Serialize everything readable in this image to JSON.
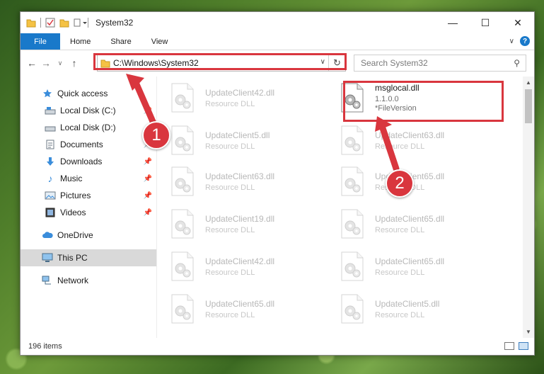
{
  "window": {
    "title": "System32"
  },
  "ribbon": {
    "tabs": [
      "File",
      "Home",
      "Share",
      "View"
    ],
    "help": "?"
  },
  "address": {
    "path": "C:\\Windows\\System32",
    "search_placeholder": "Search System32"
  },
  "nav": {
    "quick_access": "Quick access",
    "items": [
      {
        "label": "Local Disk (C:)",
        "icon": "drive-icon",
        "pinned": true
      },
      {
        "label": "Local Disk (D:)",
        "icon": "drive-icon",
        "pinned": false
      },
      {
        "label": "Documents",
        "icon": "documents-icon",
        "pinned": true
      },
      {
        "label": "Downloads",
        "icon": "downloads-icon",
        "pinned": true
      },
      {
        "label": "Music",
        "icon": "music-icon",
        "pinned": true
      },
      {
        "label": "Pictures",
        "icon": "pictures-icon",
        "pinned": true
      },
      {
        "label": "Videos",
        "icon": "videos-icon",
        "pinned": true
      }
    ],
    "onedrive": "OneDrive",
    "this_pc": "This PC",
    "network": "Network"
  },
  "files": [
    {
      "name": "UpdateClient42.dll",
      "desc": "Resource DLL"
    },
    {
      "name": "msglocal.dll",
      "desc": "1.1.0.0",
      "desc2": "*FileVersion",
      "highlight": true
    },
    {
      "name": "UpdateClient5.dll",
      "desc": "Resource DLL"
    },
    {
      "name": "UpdateClient63.dll",
      "desc": "Resource DLL"
    },
    {
      "name": "UpdateClient63.dll",
      "desc": "Resource DLL"
    },
    {
      "name": "UpdateClient65.dll",
      "desc": "Resource DLL"
    },
    {
      "name": "UpdateClient19.dll",
      "desc": "Resource DLL"
    },
    {
      "name": "UpdateClient65.dll",
      "desc": "Resource DLL"
    },
    {
      "name": "UpdateClient42.dll",
      "desc": "Resource DLL"
    },
    {
      "name": "UpdateClient65.dll",
      "desc": "Resource DLL"
    },
    {
      "name": "UpdateClient65.dll",
      "desc": "Resource DLL"
    },
    {
      "name": "UpdateClient5.dll",
      "desc": "Resource DLL"
    }
  ],
  "status": {
    "count": "196 items"
  },
  "annotations": {
    "step1": "1",
    "step2": "2"
  },
  "colors": {
    "accent": "#1979ca",
    "annotation_red": "#d9363e"
  }
}
